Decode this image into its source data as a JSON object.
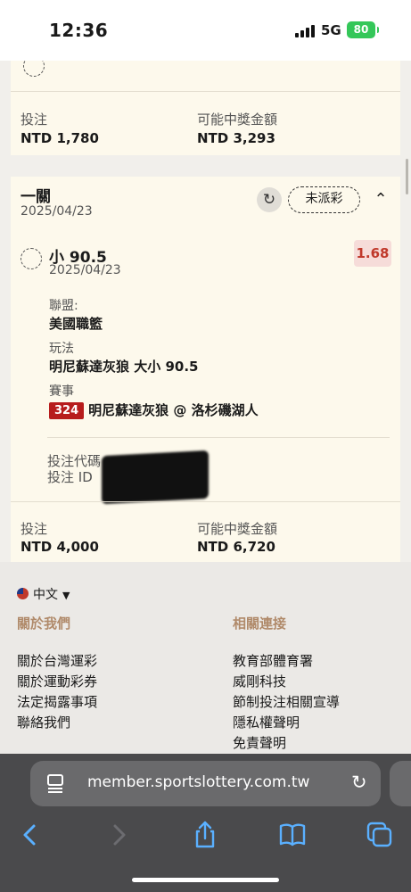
{
  "status_bar": {
    "time": "12:36",
    "network": "5G",
    "battery": "80"
  },
  "bet_card_1": {
    "stake_label": "投注",
    "stake_value": "NTD 1,780",
    "payout_label": "可能中獎金額",
    "payout_value": "NTD 3,293"
  },
  "bet_card_2": {
    "title": "一關",
    "date": "2025/04/23",
    "status": "未派彩",
    "selection": {
      "name": "小 90.5",
      "date": "2025/04/23",
      "odds": "1.68",
      "league_label": "聯盟:",
      "league_value": "美國職籃",
      "play_label": "玩法",
      "play_value": "明尼蘇達灰狼 大小 90.5",
      "match_label": "賽事",
      "match_number": "324",
      "match_value": "明尼蘇達灰狼 @ 洛杉磯湖人"
    },
    "code_label": "投注代碼",
    "id_label": "投注 ID",
    "stake_label": "投注",
    "stake_value": "NTD 4,000",
    "payout_label": "可能中獎金額",
    "payout_value": "NTD 6,720"
  },
  "footer": {
    "language": "中文",
    "col1_heading": "關於我們",
    "col1_links": [
      "關於台灣運彩",
      "關於運動彩券",
      "法定揭露事項",
      "聯絡我們"
    ],
    "col2_heading": "相關連接",
    "col2_links": [
      "教育部體育署",
      "威剛科技",
      "節制投注相關宣導",
      "隱私權聲明",
      "免責聲明"
    ]
  },
  "browser": {
    "url": "member.sportslottery.com.tw"
  },
  "colors": {
    "card_bg": "#fdf9ec",
    "odds_text": "#c0392b",
    "match_badge": "#b71c1c",
    "footer_heading": "#b08a6a",
    "toolbar_icon": "#5ab0ff"
  }
}
